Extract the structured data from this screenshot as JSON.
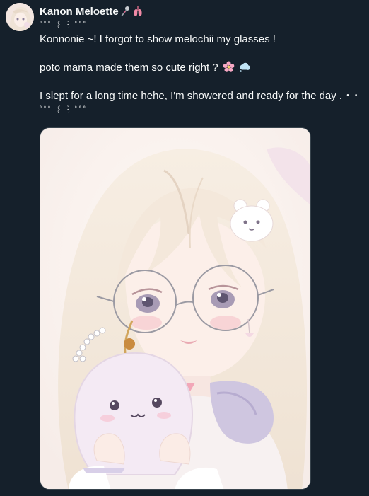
{
  "author": {
    "display_name": "Kanon Meloette",
    "name_icons": [
      "microphone-icon",
      "lungs-icon"
    ]
  },
  "tweet": {
    "lines": [
      "ﾟﾟﾟ ꒰ ꒱ ﾟﾟﾟ",
      "Konnonie ~! I forgot to show melochii my glasses !",
      "",
      "poto mama made them so cute right ?",
      "",
      "I slept for a long time hehe, I'm showered and ready for the day .  ･  ･",
      "ﾟﾟﾟ ꒰ ꒱ ﾟﾟﾟ"
    ],
    "emojis_line_4": [
      "cherry-blossom-icon",
      "speech-bubble-icon"
    ]
  },
  "media": {
    "alt": "illustration of a pale-haired girl with round glasses holding a ghost plush",
    "colors": {
      "hair": "#f4e9dc",
      "skin": "#fbeee8",
      "eyes": "#9a8fa8",
      "plush": "#f1e6f2",
      "scarf": "#c9bfdc"
    }
  }
}
